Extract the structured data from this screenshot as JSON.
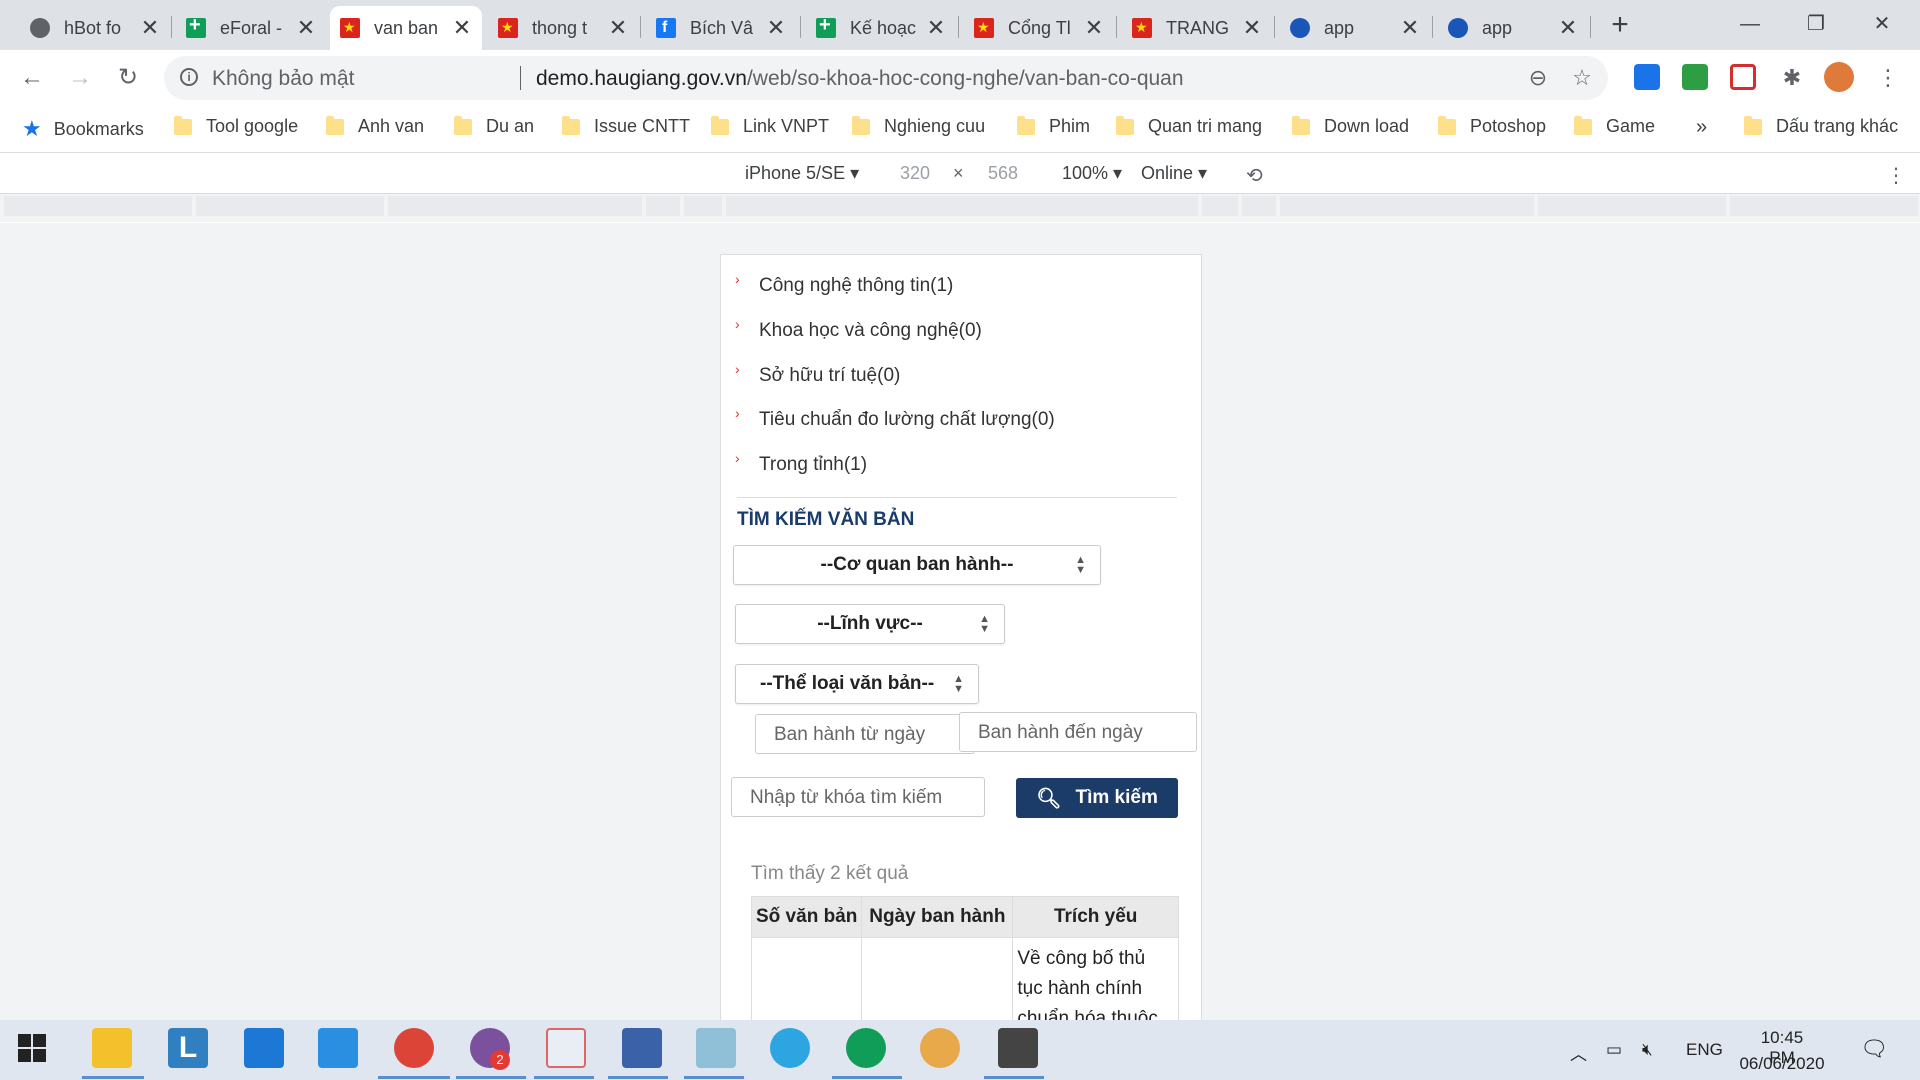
{
  "tabs": [
    {
      "title": "hBot fo",
      "icon": "globe-icon",
      "active": false
    },
    {
      "title": "eForal -",
      "icon": "sheets-icon",
      "active": false
    },
    {
      "title": "van ban",
      "icon": "vn-flag-icon",
      "active": true
    },
    {
      "title": "thong t",
      "icon": "vn-flag-icon",
      "active": false
    },
    {
      "title": "Bích Vâ",
      "icon": "facebook-icon",
      "active": false
    },
    {
      "title": "Kế hoạc",
      "icon": "sheets-icon",
      "active": false
    },
    {
      "title": "Cổng Tl",
      "icon": "vn-flag-icon",
      "active": false
    },
    {
      "title": "TRANG",
      "icon": "vn-flag-icon",
      "active": false
    },
    {
      "title": "app",
      "icon": "app-icon",
      "active": false
    },
    {
      "title": "app",
      "icon": "app-icon",
      "active": false
    }
  ],
  "omnibox": {
    "security_label": "Không bảo mật",
    "url_host": "demo.haugiang.gov.vn",
    "url_path": "/web/so-khoa-hoc-cong-nghe/van-ban-co-quan"
  },
  "bookmarks": {
    "first": "Bookmarks",
    "folders": [
      "Tool google",
      "Anh van",
      "Du an",
      "Issue CNTT",
      "Link VNPT",
      "Nghieng cuu",
      "Phim",
      "Quan tri mang",
      "Down load",
      "Potoshop",
      "Game"
    ],
    "overflow": "»",
    "other": "Dấu trang khác"
  },
  "device_toolbar": {
    "device": "iPhone 5/SE",
    "width": "320",
    "height": "568",
    "zoom": "100%",
    "network": "Online"
  },
  "page": {
    "categories": [
      "Công nghệ thông tin(1)",
      "Khoa học và công nghệ(0)",
      "Sở hữu trí tuệ(0)",
      "Tiêu chuẩn đo lường chất lượng(0)",
      "Trong tỉnh(1)"
    ],
    "search_title": "TÌM KIẾM VĂN BẢN",
    "select_agency": "--Cơ quan ban hành--",
    "select_field": "--Lĩnh vực--",
    "select_type": "--Thể loại văn bản--",
    "date_from_placeholder": "Ban hành từ ngày",
    "date_to_placeholder": "Ban hành đến ngày",
    "keyword_placeholder": "Nhập từ khóa tìm kiếm",
    "search_button": "Tìm kiếm",
    "result_count": "Tìm thấy 2 kết quả",
    "table": {
      "headers": [
        "Số văn bản",
        "Ngày ban hành",
        "Trích yếu"
      ],
      "rows": [
        [
          "",
          "",
          "Về công bố thủ tục hành chính chuẩn hóa thuộc"
        ]
      ]
    }
  },
  "taskbar": {
    "language": "ENG",
    "time": "10:45 PM",
    "date": "06/06/2020",
    "viber_badge": "2"
  }
}
